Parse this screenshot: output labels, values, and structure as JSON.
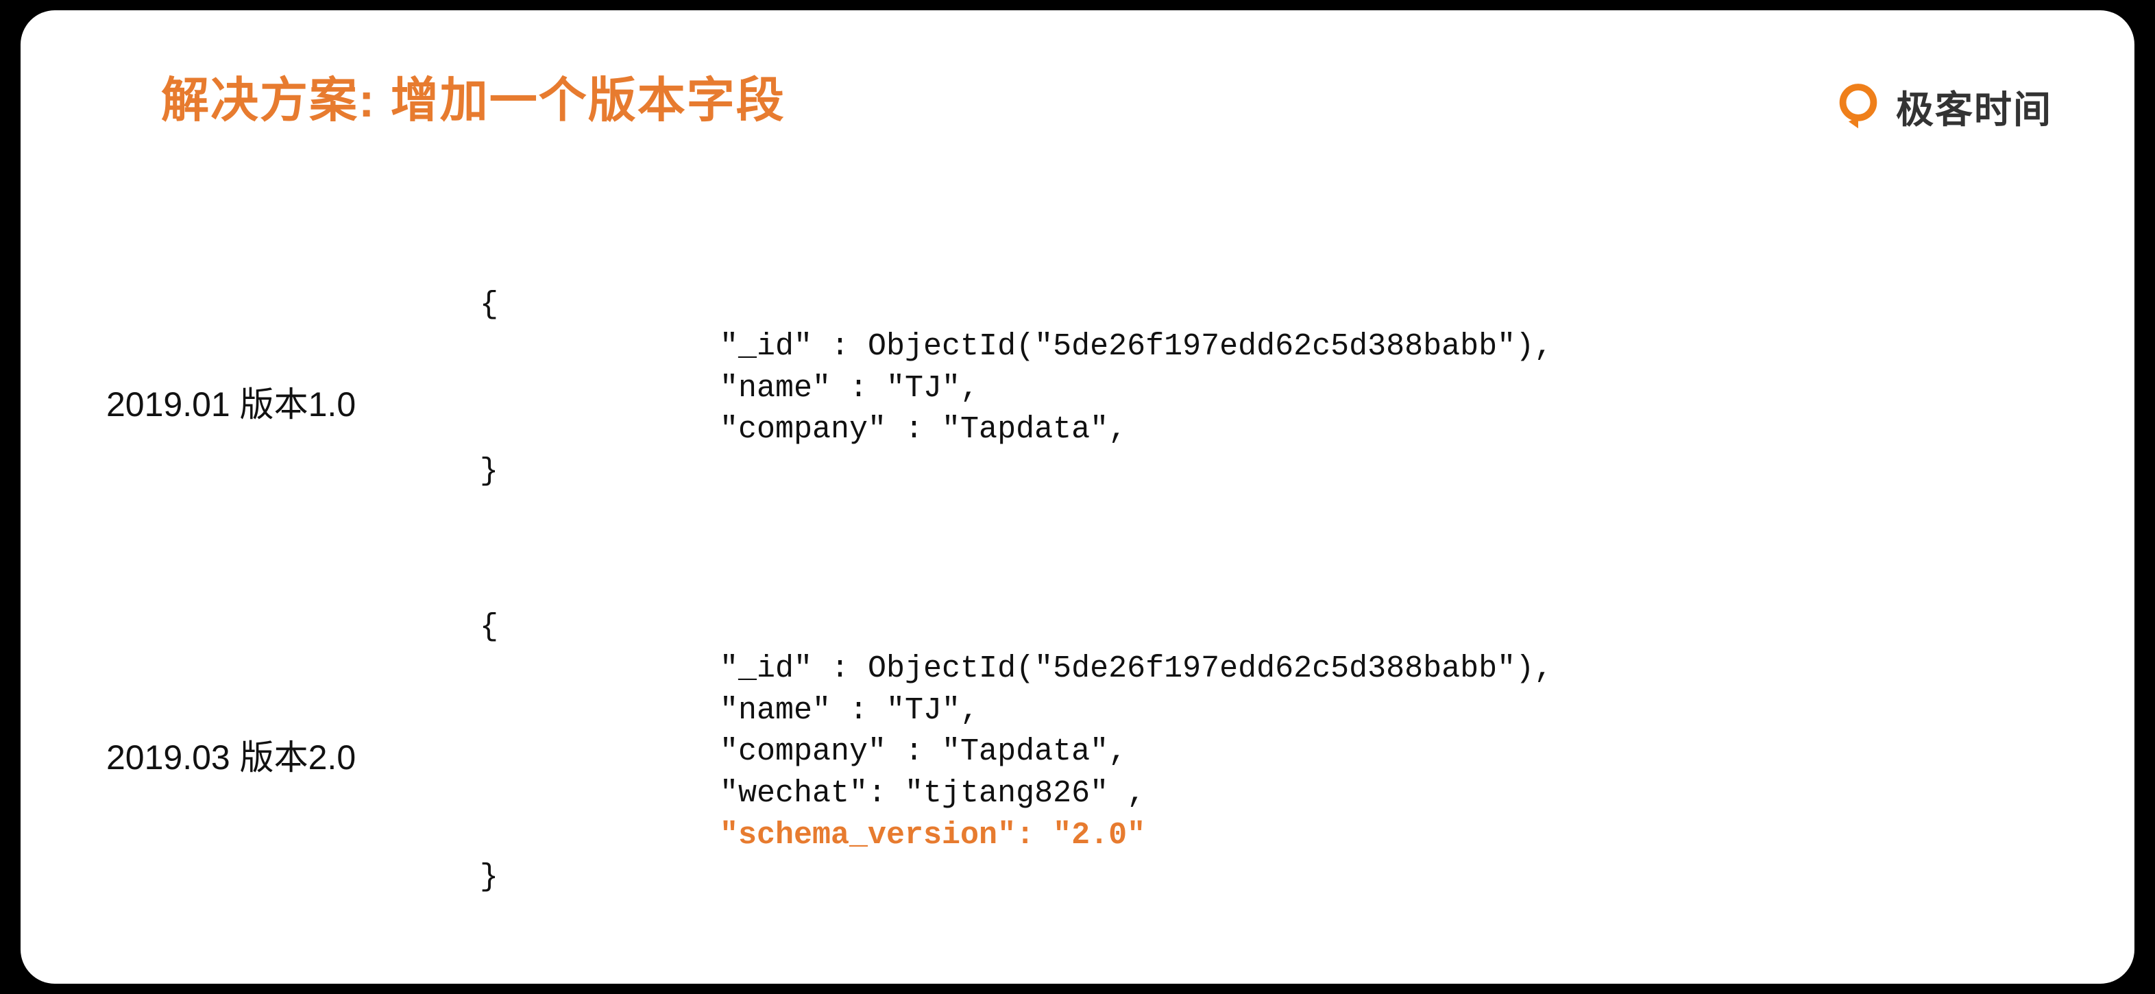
{
  "title": "解决方案: 增加一个版本字段",
  "brand": {
    "text": "极客时间"
  },
  "block1": {
    "label": "2019.01 版本1.0",
    "open": "{",
    "l1": "\"_id\" : ObjectId(\"5de26f197edd62c5d388babb\"),",
    "l2": "\"name\" : \"TJ\",",
    "l3": "\"company\" : \"Tapdata\",",
    "close": "}"
  },
  "block2": {
    "label": "2019.03 版本2.0",
    "open": "{",
    "l1": "\"_id\" : ObjectId(\"5de26f197edd62c5d388babb\"),",
    "l2": "\"name\" : \"TJ\",",
    "l3": "\"company\" : \"Tapdata\",",
    "l4": "\"wechat\": \"tjtang826\" ,",
    "l5": "\"schema_version\": \"2.0\"",
    "close": "}"
  }
}
